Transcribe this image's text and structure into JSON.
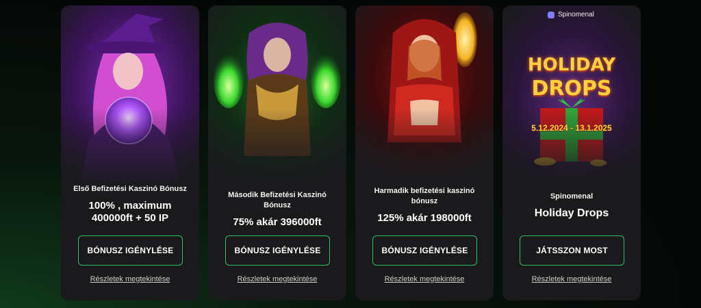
{
  "cards": [
    {
      "subtitle": "Első Befizetési Kaszinó Bónusz",
      "headline": "100% , maximum 400000ft + 50 IP",
      "button": "BÓNUSZ IGÉNYLÉSE",
      "link": "Részletek megtekintése"
    },
    {
      "subtitle": "Második Befizetési Kaszinó Bónusz",
      "headline": "75% akár 396000ft",
      "button": "BÓNUSZ IGÉNYLÉSE",
      "link": "Részletek megtekintése"
    },
    {
      "subtitle": "Harmadik befizetési kaszinó bónusz",
      "headline": "125% akár 198000ft",
      "button": "BÓNUSZ IGÉNYLÉSE",
      "link": "Részletek megtekintése"
    },
    {
      "provider_badge": "Spinomenal",
      "art_title_line1": "HOLIDAY",
      "art_title_line2": "DROPS",
      "art_dates": "5.12.2024 - 13.1.2025",
      "subtitle": "Spinomenal",
      "headline": "Holiday Drops",
      "button": "JÁTSSZON MOST",
      "link": "Részletek megtekintése"
    }
  ],
  "colors": {
    "accent": "#2cc36b",
    "card_bg": "#1a1a1d",
    "page_bg": "#050807"
  },
  "icons": [
    "witch-character-art",
    "sorceress-character-art",
    "red-hood-character-art",
    "gift-box-icon",
    "spinomenal-logo-icon"
  ]
}
